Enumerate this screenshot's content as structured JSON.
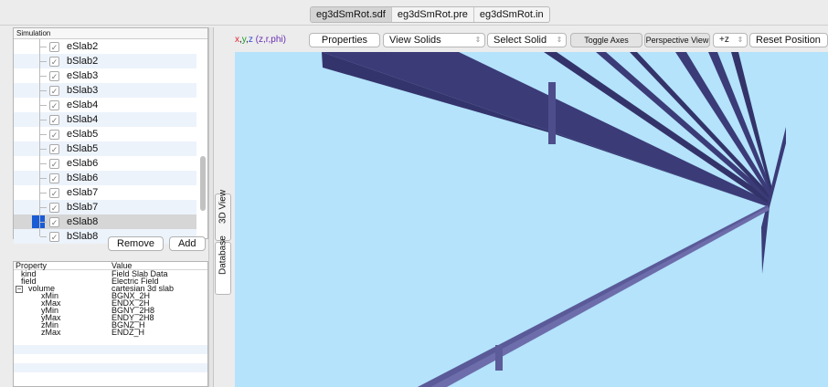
{
  "file_tabs": [
    "eg3dSmRot.sdf",
    "eg3dSmRot.pre",
    "eg3dSmRot.in"
  ],
  "simulation": {
    "header": "Simulation",
    "items": [
      {
        "label": "eSlab2",
        "checked": true
      },
      {
        "label": "bSlab2",
        "checked": true
      },
      {
        "label": "eSlab3",
        "checked": true
      },
      {
        "label": "bSlab3",
        "checked": true
      },
      {
        "label": "eSlab4",
        "checked": true
      },
      {
        "label": "bSlab4",
        "checked": true
      },
      {
        "label": "eSlab5",
        "checked": true
      },
      {
        "label": "bSlab5",
        "checked": true
      },
      {
        "label": "eSlab6",
        "checked": true
      },
      {
        "label": "bSlab6",
        "checked": true
      },
      {
        "label": "eSlab7",
        "checked": true
      },
      {
        "label": "bSlab7",
        "checked": true
      },
      {
        "label": "eSlab8",
        "checked": true,
        "selected": true
      },
      {
        "label": "bSlab8",
        "checked": true
      }
    ],
    "selected_color": "#1a5bd6",
    "remove_label": "Remove",
    "add_label": "Add"
  },
  "properties": {
    "col_property": "Property",
    "col_value": "Value",
    "rows": [
      {
        "key": "kind",
        "value": "Field Slab Data"
      },
      {
        "key": "field",
        "value": "Electric Field"
      },
      {
        "key": "volume",
        "value": "cartesian 3d slab"
      },
      {
        "key": "xMin",
        "value": "BGNX_2H"
      },
      {
        "key": "xMax",
        "value": "ENDX_2H"
      },
      {
        "key": "yMin",
        "value": "BGNY_2H8"
      },
      {
        "key": "yMax",
        "value": "ENDY_2H8"
      },
      {
        "key": "zMin",
        "value": "BGNZ_H"
      },
      {
        "key": "zMax",
        "value": "ENDZ_H"
      }
    ],
    "collapse_symbol": "−"
  },
  "side_tabs": {
    "view3d": "3D View",
    "database": "Database"
  },
  "toolbar": {
    "coord_prefix": "x,y,z",
    "coord_suffix": "(z,r,phi)",
    "properties": "Properties",
    "view_solids": "View Solids",
    "select_solid": "Select Solid",
    "toggle_axes": "Toggle Axes",
    "perspective_view": "Perspective View",
    "axis_dir": "+z",
    "reset_position": "Reset Position"
  },
  "colors": {
    "viewport_bg": "#b4e3fb",
    "slab": "#3b3b78",
    "slab_light": "#6d6dab",
    "coord_red": "#e0242d",
    "coord_blue": "#2d49d6"
  }
}
